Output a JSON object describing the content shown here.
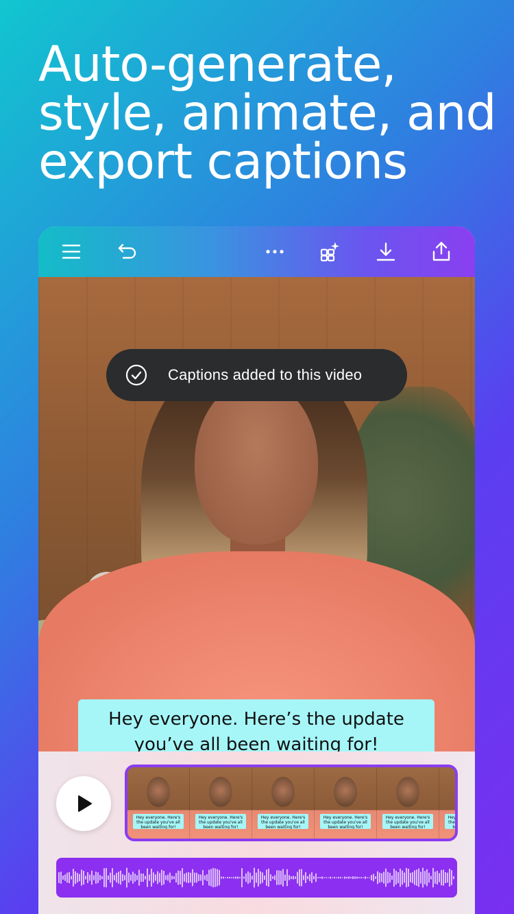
{
  "headline": {
    "lines": [
      "Auto-generate,",
      "style, animate, and",
      "export captions"
    ]
  },
  "toolbar": {
    "icons": [
      "menu-icon",
      "undo-icon",
      "more-icon",
      "magic-icon",
      "download-icon",
      "share-icon"
    ]
  },
  "toast": {
    "text": "Captions added to this video"
  },
  "caption": {
    "line1": "Hey everyone. Here’s the update",
    "line2": "you’ve all been waiting for!"
  },
  "timeline": {
    "frame_caption": "Hey everyone. Here's the update you've all been waiting for!"
  },
  "colors": {
    "accent": "#8a3df0",
    "caption_bg": "#a6f6f8",
    "toast_bg": "#2a2c2e"
  }
}
